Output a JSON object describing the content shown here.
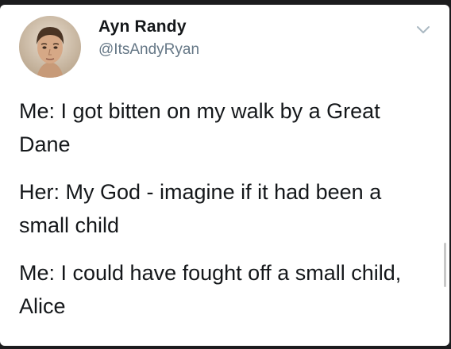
{
  "user": {
    "display_name": "Ayn Randy",
    "handle": "@ItsAndyRyan",
    "avatar_icon": "profile-photo"
  },
  "menu_icon": "chevron-down-icon",
  "tweet": {
    "paragraphs": [
      "Me: I got bitten on my walk by a Great Dane",
      "Her: My God - imagine if it had been a small child",
      "Me: I could have fought off a small child, Alice"
    ]
  }
}
